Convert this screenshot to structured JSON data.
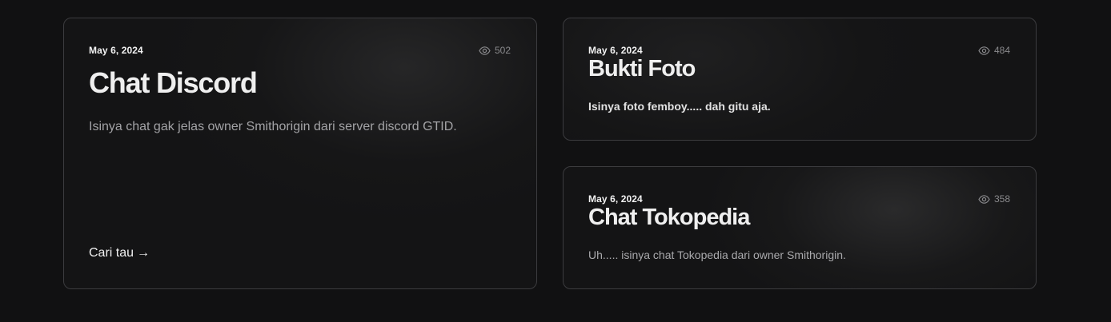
{
  "cards": [
    {
      "date": "May 6, 2024",
      "views": "502",
      "title": "Chat Discord",
      "description": "Isinya chat gak jelas owner Smithorigin dari server discord GTID.",
      "link_label": "Cari tau",
      "link_arrow": "→"
    },
    {
      "date": "May 6, 2024",
      "views": "484",
      "title": "Bukti Foto",
      "description": "Isinya foto femboy..... dah gitu aja."
    },
    {
      "date": "May 6, 2024",
      "views": "358",
      "title": "Chat Tokopedia",
      "description": "Uh..... isinya chat Tokopedia dari owner Smithorigin."
    }
  ],
  "colors": {
    "background": "#111112",
    "card_border": "#3c3c3f",
    "muted_text": "#8a8a8d"
  },
  "icons": {
    "views": "eye-icon"
  }
}
